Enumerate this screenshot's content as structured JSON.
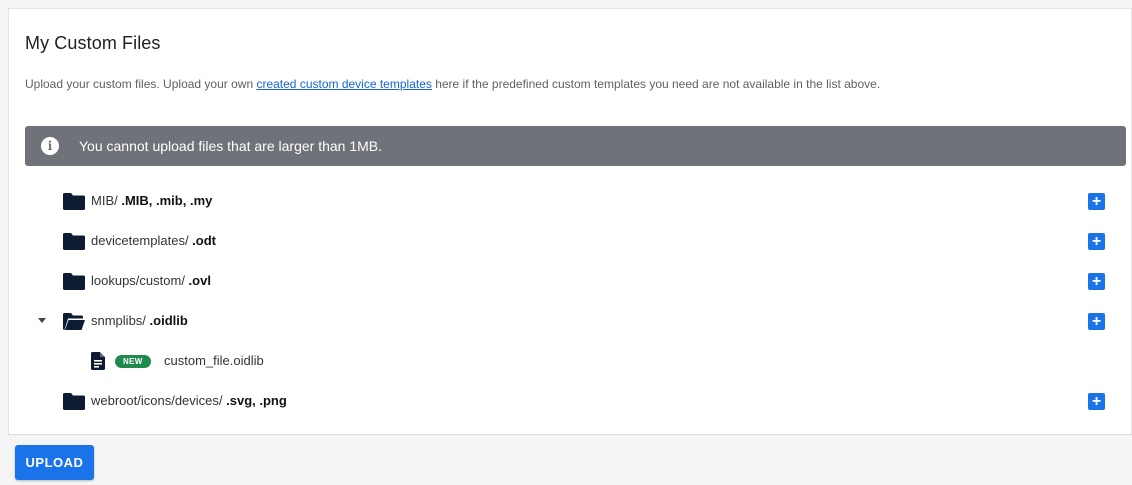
{
  "panel": {
    "title": "My Custom Files",
    "description_before": "Upload your custom files. Upload your own ",
    "description_link": "created custom device templates",
    "description_after": " here if the predefined custom templates you need are not available in the list above."
  },
  "alert": {
    "icon": "info-icon",
    "text": "You cannot upload files that are larger than 1MB."
  },
  "folders": [
    {
      "path": "MIB/ ",
      "ext": ".MIB, .mib, .my",
      "expanded": false
    },
    {
      "path": "devicetemplates/ ",
      "ext": ".odt",
      "expanded": false
    },
    {
      "path": "lookups/custom/ ",
      "ext": ".ovl",
      "expanded": false
    },
    {
      "path": "snmplibs/ ",
      "ext": ".oidlib",
      "expanded": true,
      "files": [
        {
          "name": "custom_file.oidlib",
          "badge": "NEW"
        }
      ]
    },
    {
      "path": "webroot/icons/devices/ ",
      "ext": ".svg, .png",
      "expanded": false
    }
  ],
  "add_button_label": "+",
  "footer": {
    "upload_label": "UPLOAD"
  },
  "colors": {
    "accent": "#1a73e8",
    "alert_bg": "#6f7278",
    "badge_new": "#1f8a4c",
    "folder": "#0d1b33"
  }
}
